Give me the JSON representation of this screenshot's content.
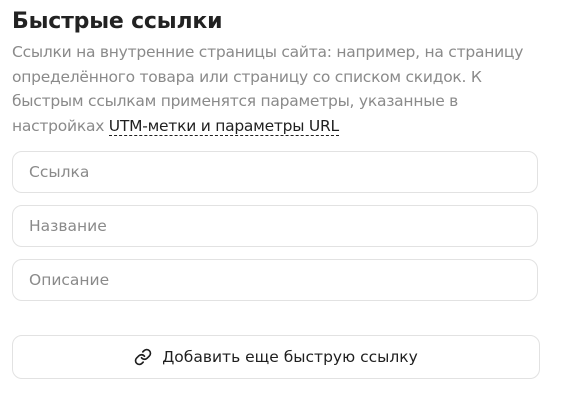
{
  "section": {
    "title": "Быстрые ссылки",
    "description_text": "Ссылки на внутренние страницы сайта: например, на страницу определённого товара или страницу со списком скидок. К быстрым ссылкам применятся параметры, указанные в настройках ",
    "description_link": "UTM-метки и параметры URL"
  },
  "fields": {
    "link_placeholder": "Ссылка",
    "name_placeholder": "Название",
    "description_placeholder": "Описание"
  },
  "add_button": {
    "label": "Добавить еще быструю ссылку",
    "icon": "link-icon"
  }
}
